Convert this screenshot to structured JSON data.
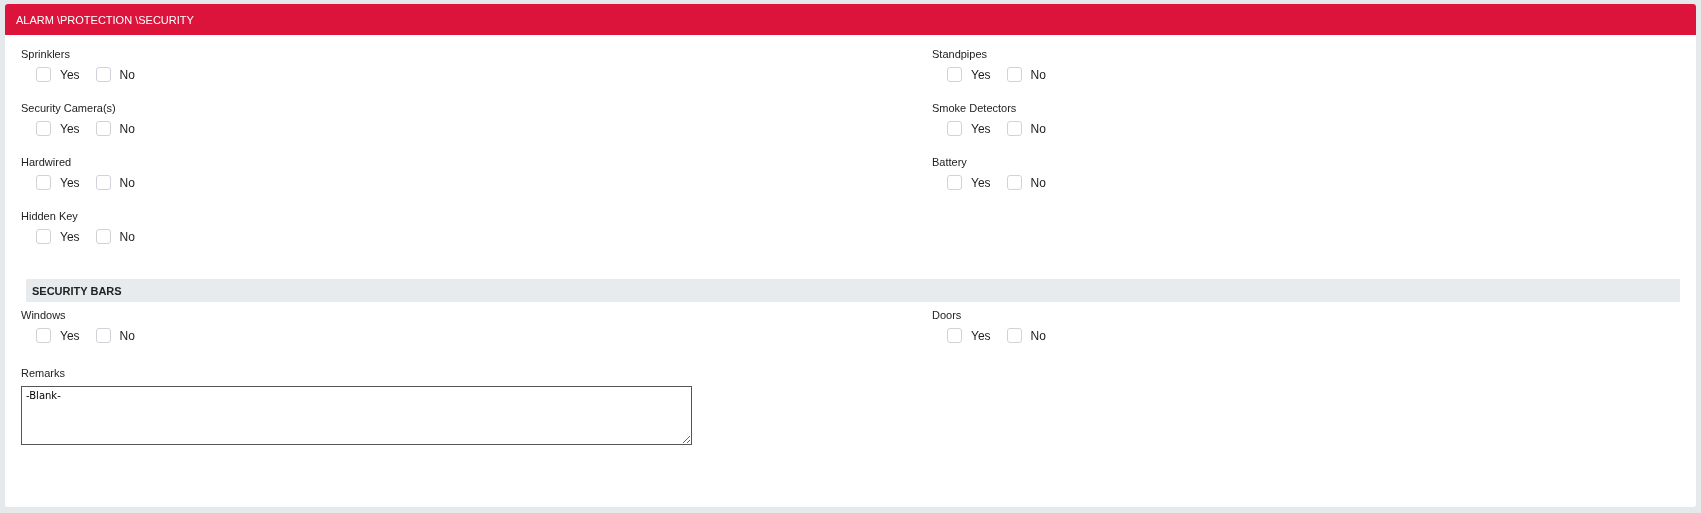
{
  "panel": {
    "title": "ALARM \\PROTECTION \\SECURITY"
  },
  "fields": [
    {
      "label": "Sprinklers",
      "options": [
        {
          "label": "Yes",
          "checked": false
        },
        {
          "label": "No",
          "checked": false
        }
      ]
    },
    {
      "label": "Standpipes",
      "options": [
        {
          "label": "Yes",
          "checked": false
        },
        {
          "label": "No",
          "checked": false
        }
      ]
    },
    {
      "label": "Security Camera(s)",
      "options": [
        {
          "label": "Yes",
          "checked": false
        },
        {
          "label": "No",
          "checked": false
        }
      ]
    },
    {
      "label": "Smoke Detectors",
      "options": [
        {
          "label": "Yes",
          "checked": false
        },
        {
          "label": "No",
          "checked": false
        }
      ]
    },
    {
      "label": "Hardwired",
      "options": [
        {
          "label": "Yes",
          "checked": false
        },
        {
          "label": "No",
          "checked": false
        }
      ]
    },
    {
      "label": "Battery",
      "options": [
        {
          "label": "Yes",
          "checked": false
        },
        {
          "label": "No",
          "checked": false
        }
      ]
    },
    {
      "label": "Hidden Key",
      "options": [
        {
          "label": "Yes",
          "checked": false
        },
        {
          "label": "No",
          "checked": false
        }
      ]
    }
  ],
  "security_bars": {
    "title": "SECURITY BARS",
    "fields": [
      {
        "label": "Windows",
        "options": [
          {
            "label": "Yes",
            "checked": false
          },
          {
            "label": "No",
            "checked": false
          }
        ]
      },
      {
        "label": "Doors",
        "options": [
          {
            "label": "Yes",
            "checked": false
          },
          {
            "label": "No",
            "checked": false
          }
        ]
      }
    ]
  },
  "remarks": {
    "label": "Remarks",
    "value": "-Blank-"
  }
}
